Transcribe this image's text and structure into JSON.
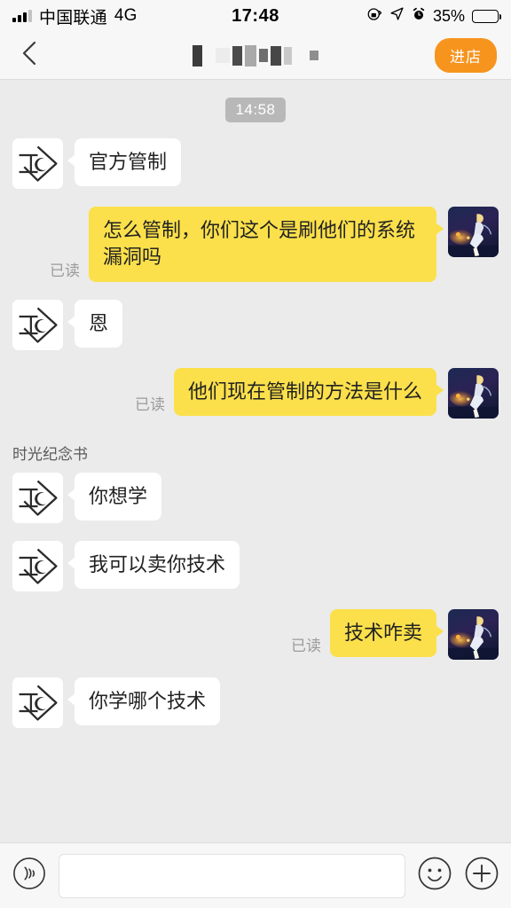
{
  "statusbar": {
    "carrier": "中国联通",
    "network": "4G",
    "time": "17:48",
    "battery_percent": "35%",
    "battery_level": 35,
    "icons": [
      "signal-icon",
      "rotation-lock-icon",
      "location-arrow-icon",
      "alarm-clock-icon",
      "battery-icon"
    ]
  },
  "navbar": {
    "back_icon": "chevron-left-icon",
    "title": "",
    "title_redacted": true,
    "enter_shop_label": "进店",
    "accent_color": "#f7941e"
  },
  "chat": {
    "timestamp": "14:58",
    "system_label": "时光纪念书",
    "read_receipt": "已读",
    "bubble_in_color": "#ffffff",
    "bubble_out_color": "#fbe04b",
    "background_color": "#ebebeb",
    "messages": [
      {
        "id": 1,
        "side": "in",
        "text": "官方管制",
        "avatar": "contact-avatar"
      },
      {
        "id": 2,
        "side": "out",
        "text": "怎么管制，你们这个是刷他们的系统漏洞吗",
        "avatar": "self-avatar",
        "read": "已读"
      },
      {
        "id": 3,
        "side": "in",
        "text": "恩",
        "avatar": "contact-avatar"
      },
      {
        "id": 4,
        "side": "out",
        "text": "他们现在管制的方法是什么",
        "avatar": "self-avatar",
        "read": "已读"
      },
      {
        "id": 5,
        "side": "in",
        "text": "你想学",
        "avatar": "contact-avatar"
      },
      {
        "id": 6,
        "side": "in",
        "text": "我可以卖你技术",
        "avatar": "contact-avatar"
      },
      {
        "id": 7,
        "side": "out",
        "text": "技术咋卖",
        "avatar": "self-avatar",
        "read": "已读"
      },
      {
        "id": 8,
        "side": "in",
        "text": "你学哪个技术",
        "avatar": "contact-avatar"
      }
    ]
  },
  "inputbar": {
    "voice_icon": "voice-wave-icon",
    "input_value": "",
    "input_placeholder": "",
    "emoji_icon": "smiley-face-icon",
    "plus_icon": "plus-circle-icon"
  }
}
